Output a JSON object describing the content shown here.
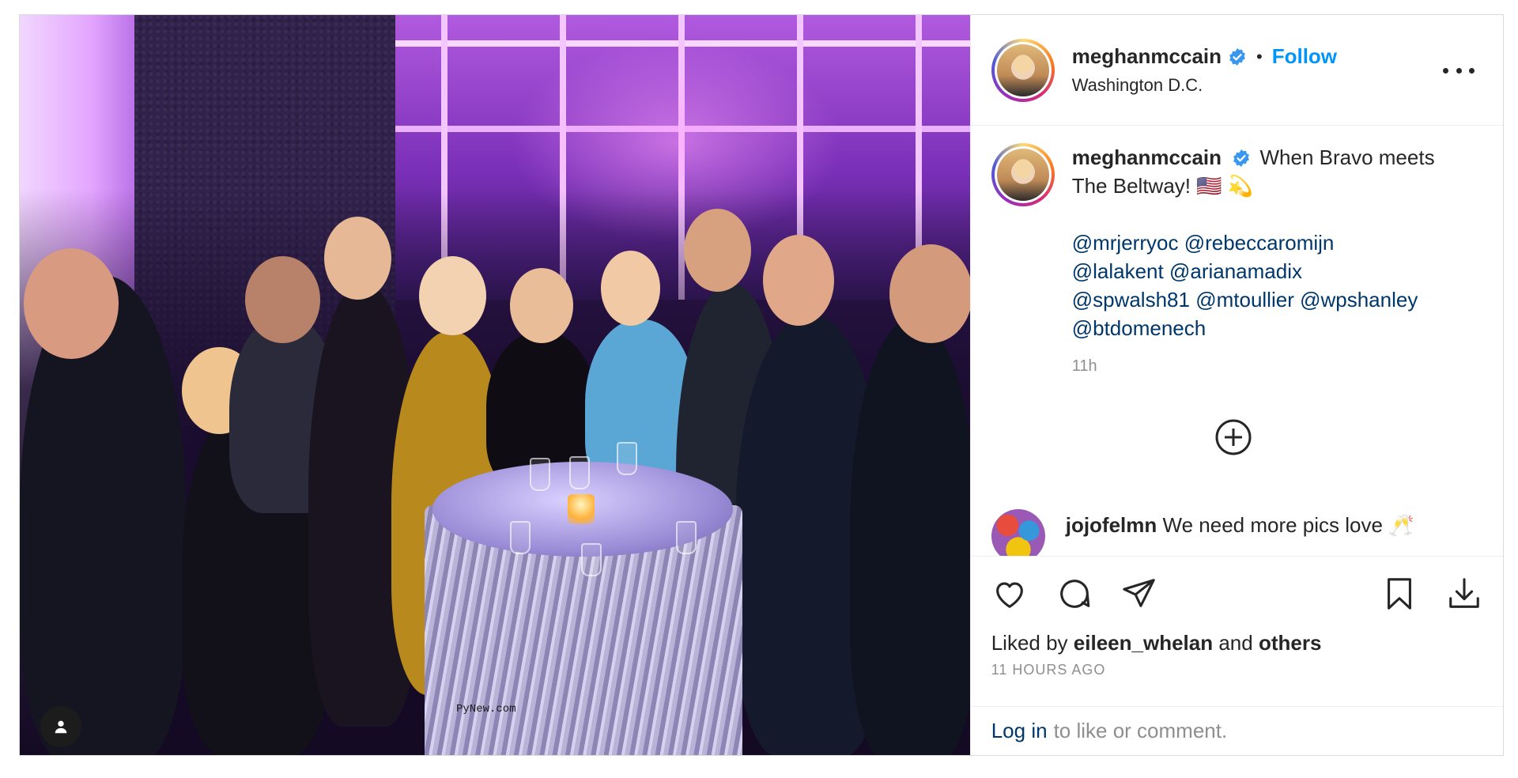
{
  "post": {
    "username": "meghanmccain",
    "separator": "•",
    "follow_label": "Follow",
    "location": "Washington D.C.",
    "watermark": "PyNew.com"
  },
  "caption": {
    "username": "meghanmccain",
    "text": "When Bravo meets The Beltway! 🇺🇸 💫",
    "mentions": [
      "@mrjerryoc",
      "@rebeccaromijn",
      "@lalakent",
      "@arianamadix",
      "@spwalsh81",
      "@mtoullier",
      "@wpshanley",
      "@btdomenech"
    ],
    "time": "11h"
  },
  "comment": {
    "username": "jojofelmn",
    "text": "We need more pics love 🥂"
  },
  "likes": {
    "prefix": "Liked by",
    "user": "eileen_whelan",
    "joiner": "and",
    "others": "others"
  },
  "timestamp": "11 HOURS AGO",
  "login": {
    "link": "Log in",
    "rest": "to like or comment."
  },
  "colors": {
    "accent": "#0095f6",
    "link": "#00376b",
    "muted": "#8e8e8e"
  }
}
